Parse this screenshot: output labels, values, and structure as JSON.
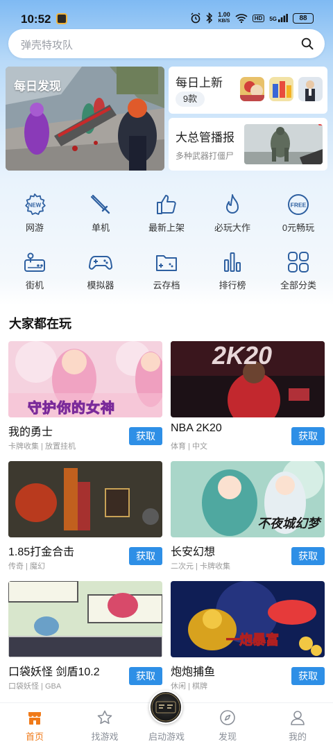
{
  "status_bar": {
    "time": "10:52",
    "net_speed_value": "1.00",
    "net_speed_unit": "KB/S",
    "hd": "HD",
    "signal": "5G",
    "battery": "88"
  },
  "search": {
    "placeholder": "弹壳特攻队"
  },
  "banners": {
    "daily_discovery": "每日发现",
    "daily_new": {
      "title": "每日上新",
      "count": "9款"
    },
    "boss_broadcast": {
      "title": "大总管播报",
      "subtitle": "多种武器打僵尸"
    }
  },
  "categories": [
    {
      "label": "网游",
      "icon": "new-icon"
    },
    {
      "label": "单机",
      "icon": "sword-icon"
    },
    {
      "label": "最新上架",
      "icon": "thumbs-up-icon"
    },
    {
      "label": "必玩大作",
      "icon": "fire-icon"
    },
    {
      "label": "0元畅玩",
      "icon": "free-icon"
    },
    {
      "label": "街机",
      "icon": "arcade-icon"
    },
    {
      "label": "模拟器",
      "icon": "gamepad-icon"
    },
    {
      "label": "云存档",
      "icon": "cloud-folder-icon"
    },
    {
      "label": "排行榜",
      "icon": "bar-chart-icon"
    },
    {
      "label": "全部分类",
      "icon": "grid-icon"
    }
  ],
  "section": {
    "title": "大家都在玩"
  },
  "games": [
    {
      "name": "我的勇士",
      "tags": "卡牌收集 | 放置挂机",
      "button": "获取",
      "banner_text": "守护你的女神"
    },
    {
      "name": "NBA 2K20",
      "tags": "体育 | 中文",
      "button": "获取",
      "banner_text": "2K20"
    },
    {
      "name": "1.85打金合击",
      "tags": "传奇 | 魔幻",
      "button": "获取"
    },
    {
      "name": "长安幻想",
      "tags": "二次元 | 卡牌收集",
      "button": "获取",
      "banner_text": "不夜城幻梦"
    },
    {
      "name": "口袋妖怪 剑盾10.2",
      "tags": "口袋妖怪 | GBA",
      "button": "获取"
    },
    {
      "name": "炮炮捕鱼",
      "tags": "休闲 | 棋牌",
      "button": "获取",
      "banner_text": "一炮暴富"
    }
  ],
  "bottom_nav": [
    {
      "label": "首页",
      "icon": "home-icon",
      "active": true
    },
    {
      "label": "找游戏",
      "icon": "star-icon",
      "active": false
    },
    {
      "label": "启动游戏",
      "icon": "launch-icon",
      "active": false
    },
    {
      "label": "发现",
      "icon": "compass-icon",
      "active": false
    },
    {
      "label": "我的",
      "icon": "user-icon",
      "active": false
    }
  ],
  "colors": {
    "accent_blue": "#2e8fe6",
    "nav_active": "#f07a19",
    "icon_blue": "#2d5fa0"
  }
}
